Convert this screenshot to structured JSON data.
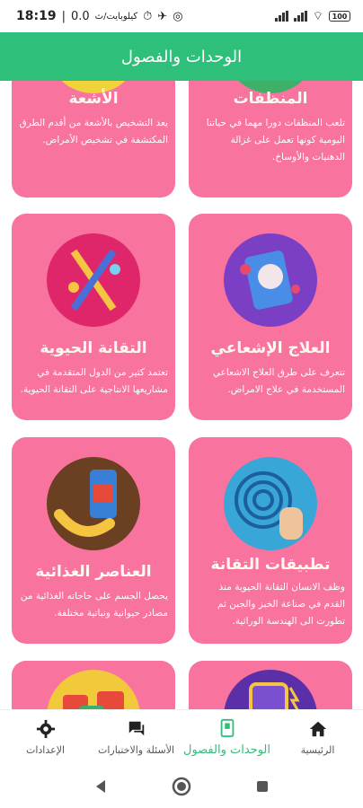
{
  "status_bar": {
    "time": "18:19",
    "speed": "0.0",
    "speed_unit": "كيلوبايت/ث",
    "battery": "100"
  },
  "app_bar": {
    "title": "الوحدات والفصول"
  },
  "cards": [
    {
      "title": "المنظفات",
      "description": "تلعب المنظفات دورا مهما في حياتنا اليومية كونها تعمل على غزالة الدهنيات والأوساخ.",
      "icon": "detergent-icon"
    },
    {
      "title": "الأشعة",
      "description": "يعد التشخيص بالأشعة من أقدم الطرق المكتشفة في تشخيص الأمراض.",
      "icon": "xray-icon"
    },
    {
      "title": "العلاج الإشعاعي",
      "description": "تتعرف على طرق العلاج الاشعاعي المستخدمة في علاج الامراض.",
      "icon": "radiotherapy-icon"
    },
    {
      "title": "التقانة الحيوية",
      "description": "تعتمد كثير من الدول المتقدمة في مشاريعها الانتاجية على التقانة الحيوية.",
      "icon": "dna-icon"
    },
    {
      "title": "تطبيقات التقانة",
      "description": "وظف الانسان التقانة الحيوية منذ القدم في صناعة الخبز والجبن ثم تطورت الى الهندسة الوراثية.",
      "icon": "fingerprint-icon"
    },
    {
      "title": "العناصر الغذائية",
      "description": "يحصل الجسم على حاجاته الغذائية من مصادر حيوانية ونباتية مختلفة.",
      "icon": "banana-battery-icon"
    },
    {
      "title": "",
      "description": "",
      "icon": "jar-icon"
    },
    {
      "title": "",
      "description": "",
      "icon": "food-icon"
    }
  ],
  "bottom_nav": {
    "items": [
      {
        "label": "الرئيسية",
        "icon": "home-icon"
      },
      {
        "label": "الوحدات والفصول",
        "icon": "book-icon"
      },
      {
        "label": "الأسئلة والاختبارات",
        "icon": "chat-icon"
      },
      {
        "label": "الإعدادات",
        "icon": "gear-icon"
      }
    ]
  },
  "colors": {
    "primary": "#2ebf7a",
    "card": "#f9739f"
  }
}
